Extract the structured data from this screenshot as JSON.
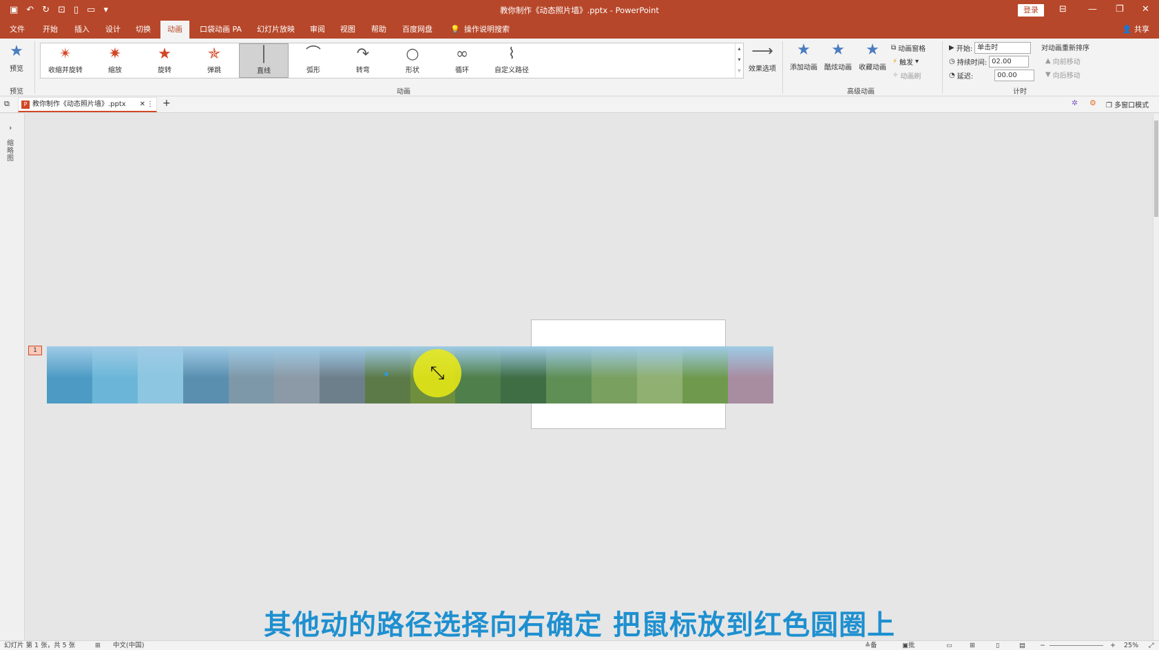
{
  "window": {
    "title": "教你制作《动态照片墙》.pptx - PowerPoint",
    "login": "登录"
  },
  "tabs": [
    "文件",
    "开始",
    "插入",
    "设计",
    "切换",
    "动画",
    "口袋动画 PA",
    "幻灯片放映",
    "审阅",
    "视图",
    "帮助",
    "百度网盘",
    "操作说明搜索"
  ],
  "share": "共享",
  "ribbon": {
    "preview": "预览",
    "preview_group": "预览",
    "gallery": [
      "收缩并旋转",
      "缩放",
      "旋转",
      "弹跳",
      "直线",
      "弧形",
      "转弯",
      "形状",
      "循环",
      "自定义路径"
    ],
    "gallery_selected": "直线",
    "animation_group": "动画",
    "effect_options": "效果选项",
    "add_animation": "添加动画",
    "animation_painter": "酷炫动画",
    "favorite_animation": "收藏动画",
    "animation_pane": "动画窗格",
    "trigger": "触发",
    "anim_brush": "动画刷",
    "advanced_group": "高级动画",
    "start_label": "开始:",
    "start_value": "单击时",
    "duration_label": "持续时间:",
    "duration_value": "02.00",
    "delay_label": "延迟:",
    "delay_value": "00.00",
    "timing_group": "计时",
    "reorder": "对动画重新排序",
    "move_earlier": "向前移动",
    "move_later": "向后移动"
  },
  "doc_tab": {
    "name": "教你制作《动态照片墙》.pptx",
    "multi_window": "多窗口模式"
  },
  "left_panel": {
    "label": "缩略图"
  },
  "slide": {
    "number": "1"
  },
  "photos": [
    "#4d9bc4",
    "#6bb6d8",
    "#8cc6e0",
    "#5a8fb0",
    "#7d98a8",
    "#8b9aa6",
    "#6e7f8c",
    "#5c7a48",
    "#6f8f3e",
    "#4f7f4a",
    "#3f6e45",
    "#5f8f55",
    "#7aa060",
    "#8fb070",
    "#6f9a4e",
    "#a88ca0"
  ],
  "subtitle": "其他动的路径选择向右确定 把鼠标放到红色圆圈上",
  "status": {
    "slide_info": "幻灯片 第 1 张，共 5 张",
    "language": "中文(中国)",
    "notes": "备注",
    "comments": "批注",
    "zoom": "25%"
  }
}
